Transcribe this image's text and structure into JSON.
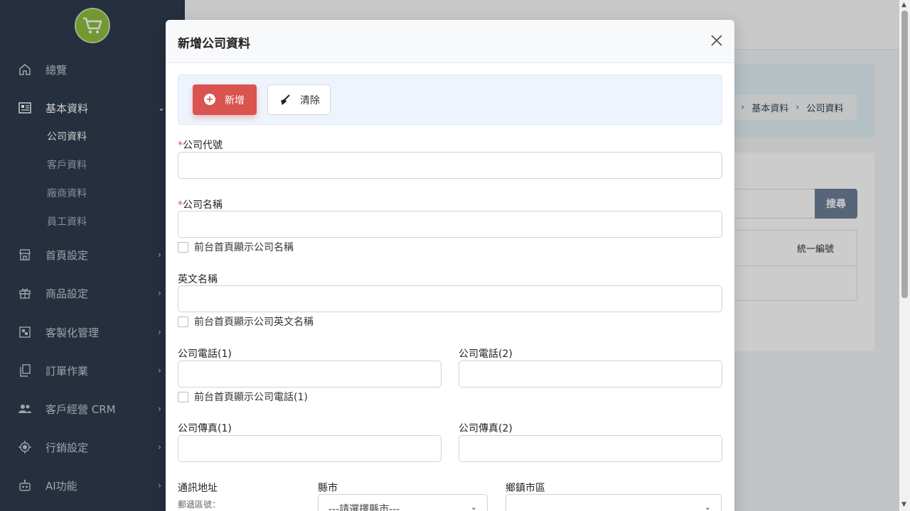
{
  "sidebar": {
    "logo_icon": "shopping-cart-icon",
    "items": [
      {
        "label": "總覽",
        "icon": "home-icon"
      },
      {
        "label": "基本資料",
        "icon": "newspaper-icon",
        "expanded": true,
        "subitems": [
          "公司資料",
          "客戶資料",
          "廠商資料",
          "員工資料"
        ],
        "active_sub": "公司資料"
      },
      {
        "label": "首頁設定",
        "icon": "store-icon"
      },
      {
        "label": "商品設定",
        "icon": "gift-icon"
      },
      {
        "label": "客製化管理",
        "icon": "puzzle-icon"
      },
      {
        "label": "訂單作業",
        "icon": "copy-icon"
      },
      {
        "label": "客戶經營 CRM",
        "icon": "users-icon"
      },
      {
        "label": "行銷設定",
        "icon": "target-icon"
      },
      {
        "label": "AI功能",
        "icon": "robot-icon"
      }
    ]
  },
  "background": {
    "breadcrumb": [
      "基本資料",
      "公司資料"
    ],
    "search_button": "搜尋",
    "table_header": "統一編號"
  },
  "modal": {
    "title": "新增公司資料",
    "add_button": "新增",
    "clear_button": "清除",
    "fields": {
      "company_code": {
        "label": "公司代號",
        "required": "*",
        "value": ""
      },
      "company_name": {
        "label": "公司名稱",
        "required": "*",
        "value": "",
        "checkbox": "前台首頁顯示公司名稱"
      },
      "english_name": {
        "label": "英文名稱",
        "value": "",
        "checkbox": "前台首頁顯示公司英文名稱"
      },
      "phone1": {
        "label": "公司電話(1)",
        "value": "",
        "checkbox": "前台首頁顯示公司電話(1)"
      },
      "phone2": {
        "label": "公司電話(2)",
        "value": ""
      },
      "fax1": {
        "label": "公司傳真(1)",
        "value": ""
      },
      "fax2": {
        "label": "公司傳真(2)",
        "value": ""
      },
      "address": {
        "label": "通訊地址",
        "postal_label": "郵遞區號："
      },
      "county": {
        "label": "縣市",
        "selected": "---請選擇縣市---"
      },
      "district": {
        "label": "鄉鎮市區",
        "selected": ""
      }
    }
  },
  "colors": {
    "sidebar_bg": "#2f3b4d",
    "accent_red": "#d9534f",
    "search_button": "#6c7f97"
  }
}
